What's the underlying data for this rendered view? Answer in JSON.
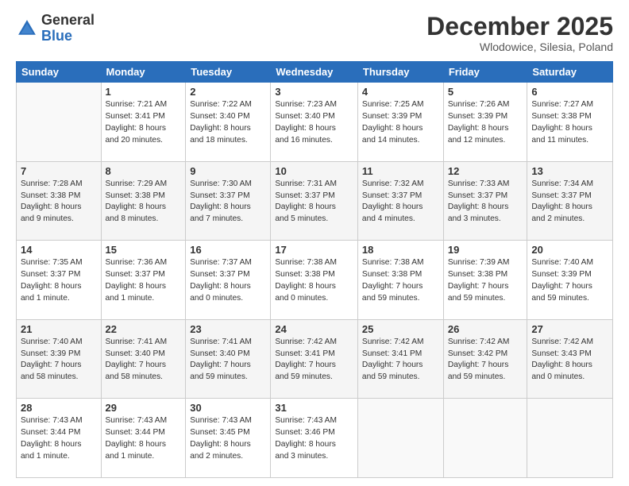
{
  "header": {
    "logo_general": "General",
    "logo_blue": "Blue",
    "month_title": "December 2025",
    "location": "Wlodowice, Silesia, Poland"
  },
  "weekdays": [
    "Sunday",
    "Monday",
    "Tuesday",
    "Wednesday",
    "Thursday",
    "Friday",
    "Saturday"
  ],
  "rows": [
    [
      {
        "day": "",
        "text": ""
      },
      {
        "day": "1",
        "text": "Sunrise: 7:21 AM\nSunset: 3:41 PM\nDaylight: 8 hours\nand 20 minutes."
      },
      {
        "day": "2",
        "text": "Sunrise: 7:22 AM\nSunset: 3:40 PM\nDaylight: 8 hours\nand 18 minutes."
      },
      {
        "day": "3",
        "text": "Sunrise: 7:23 AM\nSunset: 3:40 PM\nDaylight: 8 hours\nand 16 minutes."
      },
      {
        "day": "4",
        "text": "Sunrise: 7:25 AM\nSunset: 3:39 PM\nDaylight: 8 hours\nand 14 minutes."
      },
      {
        "day": "5",
        "text": "Sunrise: 7:26 AM\nSunset: 3:39 PM\nDaylight: 8 hours\nand 12 minutes."
      },
      {
        "day": "6",
        "text": "Sunrise: 7:27 AM\nSunset: 3:38 PM\nDaylight: 8 hours\nand 11 minutes."
      }
    ],
    [
      {
        "day": "7",
        "text": "Sunrise: 7:28 AM\nSunset: 3:38 PM\nDaylight: 8 hours\nand 9 minutes."
      },
      {
        "day": "8",
        "text": "Sunrise: 7:29 AM\nSunset: 3:38 PM\nDaylight: 8 hours\nand 8 minutes."
      },
      {
        "day": "9",
        "text": "Sunrise: 7:30 AM\nSunset: 3:37 PM\nDaylight: 8 hours\nand 7 minutes."
      },
      {
        "day": "10",
        "text": "Sunrise: 7:31 AM\nSunset: 3:37 PM\nDaylight: 8 hours\nand 5 minutes."
      },
      {
        "day": "11",
        "text": "Sunrise: 7:32 AM\nSunset: 3:37 PM\nDaylight: 8 hours\nand 4 minutes."
      },
      {
        "day": "12",
        "text": "Sunrise: 7:33 AM\nSunset: 3:37 PM\nDaylight: 8 hours\nand 3 minutes."
      },
      {
        "day": "13",
        "text": "Sunrise: 7:34 AM\nSunset: 3:37 PM\nDaylight: 8 hours\nand 2 minutes."
      }
    ],
    [
      {
        "day": "14",
        "text": "Sunrise: 7:35 AM\nSunset: 3:37 PM\nDaylight: 8 hours\nand 1 minute."
      },
      {
        "day": "15",
        "text": "Sunrise: 7:36 AM\nSunset: 3:37 PM\nDaylight: 8 hours\nand 1 minute."
      },
      {
        "day": "16",
        "text": "Sunrise: 7:37 AM\nSunset: 3:37 PM\nDaylight: 8 hours\nand 0 minutes."
      },
      {
        "day": "17",
        "text": "Sunrise: 7:38 AM\nSunset: 3:38 PM\nDaylight: 8 hours\nand 0 minutes."
      },
      {
        "day": "18",
        "text": "Sunrise: 7:38 AM\nSunset: 3:38 PM\nDaylight: 7 hours\nand 59 minutes."
      },
      {
        "day": "19",
        "text": "Sunrise: 7:39 AM\nSunset: 3:38 PM\nDaylight: 7 hours\nand 59 minutes."
      },
      {
        "day": "20",
        "text": "Sunrise: 7:40 AM\nSunset: 3:39 PM\nDaylight: 7 hours\nand 59 minutes."
      }
    ],
    [
      {
        "day": "21",
        "text": "Sunrise: 7:40 AM\nSunset: 3:39 PM\nDaylight: 7 hours\nand 58 minutes."
      },
      {
        "day": "22",
        "text": "Sunrise: 7:41 AM\nSunset: 3:40 PM\nDaylight: 7 hours\nand 58 minutes."
      },
      {
        "day": "23",
        "text": "Sunrise: 7:41 AM\nSunset: 3:40 PM\nDaylight: 7 hours\nand 59 minutes."
      },
      {
        "day": "24",
        "text": "Sunrise: 7:42 AM\nSunset: 3:41 PM\nDaylight: 7 hours\nand 59 minutes."
      },
      {
        "day": "25",
        "text": "Sunrise: 7:42 AM\nSunset: 3:41 PM\nDaylight: 7 hours\nand 59 minutes."
      },
      {
        "day": "26",
        "text": "Sunrise: 7:42 AM\nSunset: 3:42 PM\nDaylight: 7 hours\nand 59 minutes."
      },
      {
        "day": "27",
        "text": "Sunrise: 7:42 AM\nSunset: 3:43 PM\nDaylight: 8 hours\nand 0 minutes."
      }
    ],
    [
      {
        "day": "28",
        "text": "Sunrise: 7:43 AM\nSunset: 3:44 PM\nDaylight: 8 hours\nand 1 minute."
      },
      {
        "day": "29",
        "text": "Sunrise: 7:43 AM\nSunset: 3:44 PM\nDaylight: 8 hours\nand 1 minute."
      },
      {
        "day": "30",
        "text": "Sunrise: 7:43 AM\nSunset: 3:45 PM\nDaylight: 8 hours\nand 2 minutes."
      },
      {
        "day": "31",
        "text": "Sunrise: 7:43 AM\nSunset: 3:46 PM\nDaylight: 8 hours\nand 3 minutes."
      },
      {
        "day": "",
        "text": ""
      },
      {
        "day": "",
        "text": ""
      },
      {
        "day": "",
        "text": ""
      }
    ]
  ]
}
